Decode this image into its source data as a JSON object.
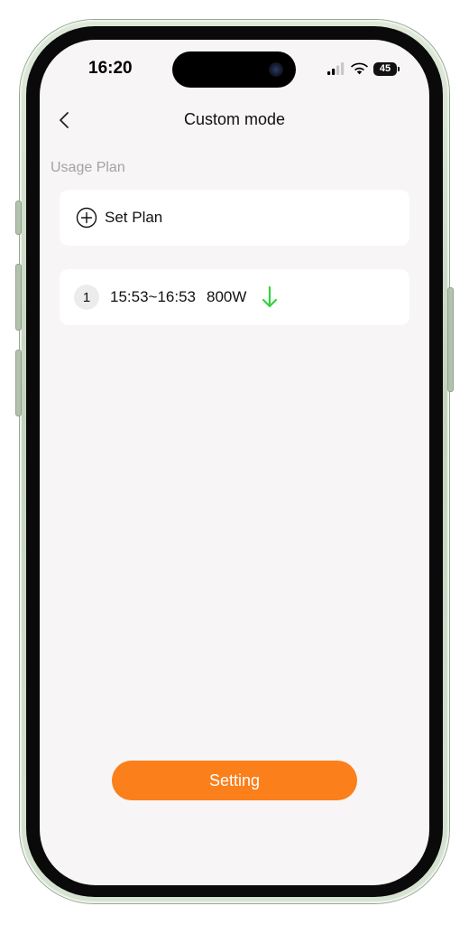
{
  "status_bar": {
    "time": "16:20",
    "battery": "45"
  },
  "nav": {
    "title": "Custom mode"
  },
  "section": {
    "label": "Usage Plan"
  },
  "set_plan": {
    "label": "Set Plan"
  },
  "plans": [
    {
      "index": "1",
      "time_range": "15:53~16:53",
      "power": "800W",
      "direction": "down"
    }
  ],
  "footer": {
    "button_label": "Setting"
  },
  "colors": {
    "accent": "#fb7f1b",
    "charge_arrow": "#2fd43d",
    "background": "#f7f5f5",
    "card": "#ffffff"
  }
}
